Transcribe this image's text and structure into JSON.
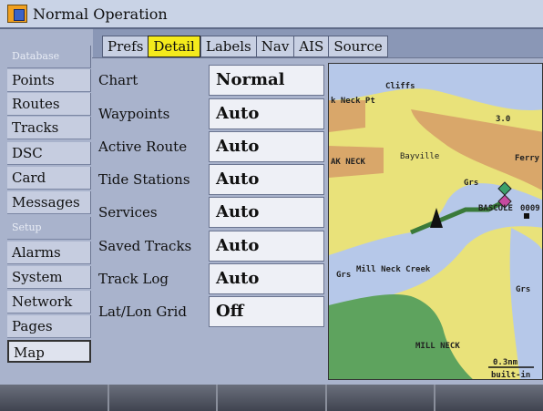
{
  "window": {
    "title": "Normal Operation"
  },
  "sidebar": {
    "items": [
      {
        "label": "Database",
        "type": "header"
      },
      {
        "label": "Points",
        "type": "button"
      },
      {
        "label": "Routes",
        "type": "button"
      },
      {
        "label": "Tracks",
        "type": "button"
      },
      {
        "label": "DSC",
        "type": "button"
      },
      {
        "label": "Card",
        "type": "button"
      },
      {
        "label": "Messages",
        "type": "button"
      },
      {
        "label": "Setup",
        "type": "header"
      },
      {
        "label": "Alarms",
        "type": "button"
      },
      {
        "label": "System",
        "type": "button"
      },
      {
        "label": "Network",
        "type": "button"
      },
      {
        "label": "Pages",
        "type": "button"
      },
      {
        "label": "Map",
        "type": "button",
        "selected": true
      }
    ]
  },
  "tabs": [
    "Prefs",
    "Detail",
    "Labels",
    "Nav",
    "AIS",
    "Source"
  ],
  "active_tab": "Detail",
  "settings": [
    {
      "label": "Chart",
      "value": "Normal"
    },
    {
      "label": "Waypoints",
      "value": "Auto"
    },
    {
      "label": "Active Route",
      "value": "Auto"
    },
    {
      "label": "Tide Stations",
      "value": "Auto"
    },
    {
      "label": "Services",
      "value": "Auto"
    },
    {
      "label": "Saved Tracks",
      "value": "Auto"
    },
    {
      "label": "Track Log",
      "value": "Auto"
    },
    {
      "label": "Lat/Lon Grid",
      "value": "Off"
    }
  ],
  "map": {
    "labels": {
      "cliffs": "Cliffs",
      "neck_pt": "k Neck Pt",
      "depth": "3.0",
      "bayville": "Bayville",
      "ak_neck": "AK NECK",
      "ferry": "Ferry I",
      "grs1": "Grs",
      "bascule": "BASCULE",
      "bascule_num": "0009",
      "mill_neck_creek": "Mill Neck Creek",
      "grs2": "Grs",
      "grs3": "Grs",
      "mill_neck": "MILL NECK",
      "scale": "0.3nm",
      "builtin": "built-in"
    },
    "colors": {
      "land": "#e9e27a",
      "water": "#b6c8e9",
      "urban": "#d9a76a",
      "shore": "#5ea35e"
    }
  },
  "softkeys": [
    "",
    "",
    "",
    "",
    ""
  ]
}
